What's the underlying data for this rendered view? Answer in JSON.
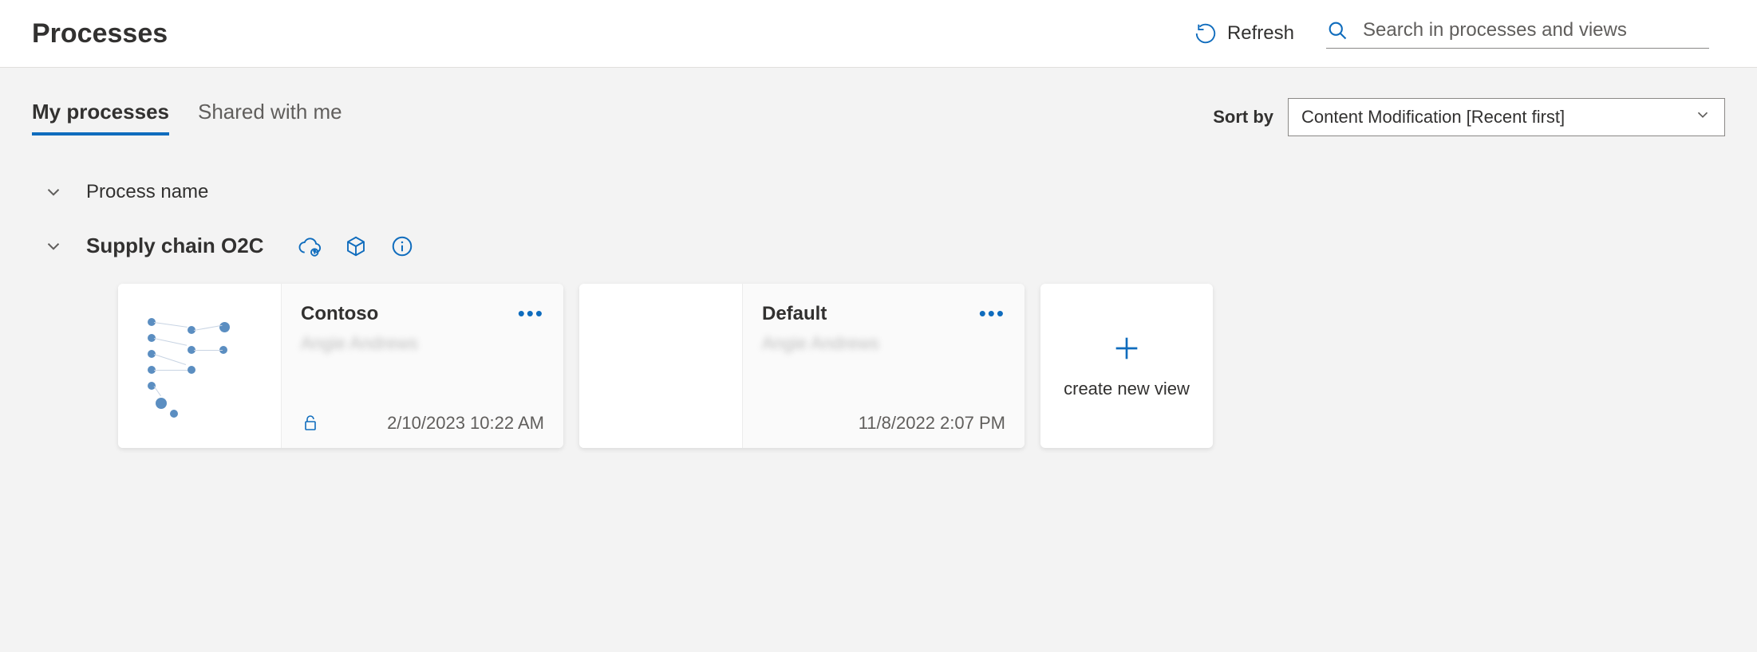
{
  "header": {
    "title": "Processes",
    "refresh_label": "Refresh",
    "search_placeholder": "Search in processes and views"
  },
  "tabs": {
    "my_processes": "My processes",
    "shared_with_me": "Shared with me"
  },
  "sort": {
    "label": "Sort by",
    "selected": "Content Modification [Recent first]"
  },
  "list_header": {
    "column_name": "Process name"
  },
  "group": {
    "name": "Supply chain O2C",
    "cards": [
      {
        "title": "Contoso",
        "owner": "Angie Andrews",
        "date": "2/10/2023 10:22 AM",
        "has_lock": true,
        "has_thumb": true
      },
      {
        "title": "Default",
        "owner": "Angie Andrews",
        "date": "11/8/2022 2:07 PM",
        "has_lock": false,
        "has_thumb": false
      }
    ]
  },
  "create_label": "create new view"
}
